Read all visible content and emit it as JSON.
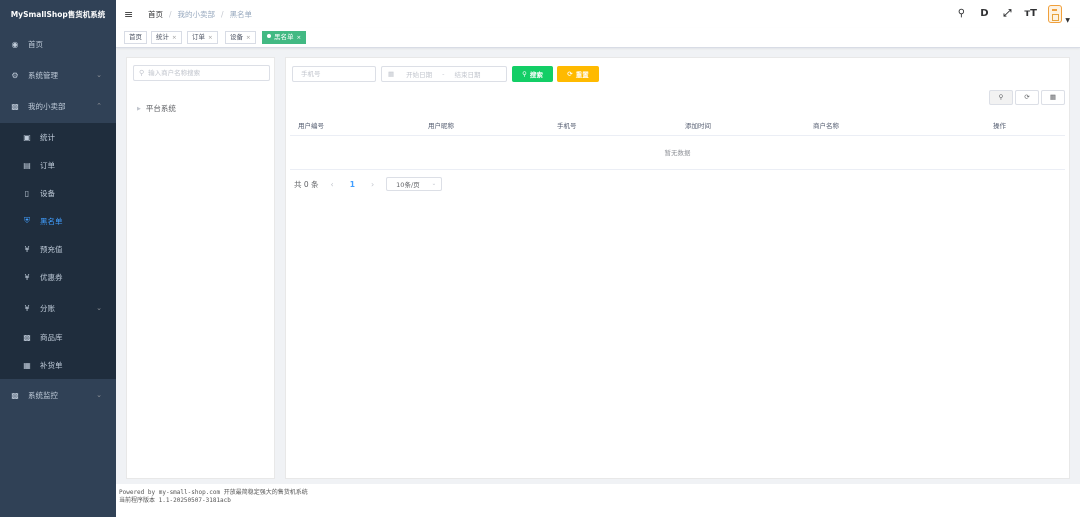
{
  "app": {
    "title": "MySmallShop售货机系统"
  },
  "sidebar": {
    "items": [
      {
        "label": "首页",
        "icon": "dashboard-icon"
      },
      {
        "label": "系统管理",
        "icon": "gear-icon"
      },
      {
        "label": "我的小卖部",
        "icon": "cart-icon"
      },
      {
        "label": "统计",
        "icon": "chart-icon"
      },
      {
        "label": "订单",
        "icon": "order-icon"
      },
      {
        "label": "设备",
        "icon": "device-icon"
      },
      {
        "label": "黑名单",
        "icon": "shield-icon"
      },
      {
        "label": "预充值",
        "icon": "yen-icon"
      },
      {
        "label": "优惠券",
        "icon": "yen-icon"
      },
      {
        "label": "分账",
        "icon": "yen-icon"
      },
      {
        "label": "商品库",
        "icon": "cart-icon"
      },
      {
        "label": "补货单",
        "icon": "calendar-icon"
      },
      {
        "label": "系统监控",
        "icon": "monitor-icon"
      }
    ],
    "active": "黑名单"
  },
  "breadcrumb": [
    "首页",
    "我的小卖部",
    "黑名单"
  ],
  "tags": [
    "首页",
    "统计",
    "订单",
    "设备",
    "黑名单"
  ],
  "tree": {
    "search_placeholder": "输入商户名称搜索",
    "nodes": [
      "平台系统"
    ]
  },
  "filters": {
    "phone_placeholder": "手机号",
    "start_placeholder": "开始日期",
    "range_sep": "-",
    "end_placeholder": "结束日期",
    "search_label": "搜索",
    "reset_label": "重置"
  },
  "table": {
    "columns": [
      "用户编号",
      "用户昵称",
      "手机号",
      "添加时间",
      "商户名称",
      "操作"
    ],
    "empty_text": "暂无数据"
  },
  "pagination": {
    "total_text": "共 0 条",
    "current_page": "1",
    "page_size": "10条/页"
  },
  "footer": {
    "line1_prefix": "Powered by my-small-shop.com",
    "line1_suffix": "开放最简稳定强大的售货机系统",
    "line2_prefix": "当前程序版本",
    "line2_version": "1.1-20250507-3181acb"
  },
  "colors": {
    "sidebar_bg": "#304156",
    "active_menu": "#409eff",
    "tag_active": "#42b983",
    "search_btn": "#13ce66",
    "reset_btn": "#ffba00"
  }
}
